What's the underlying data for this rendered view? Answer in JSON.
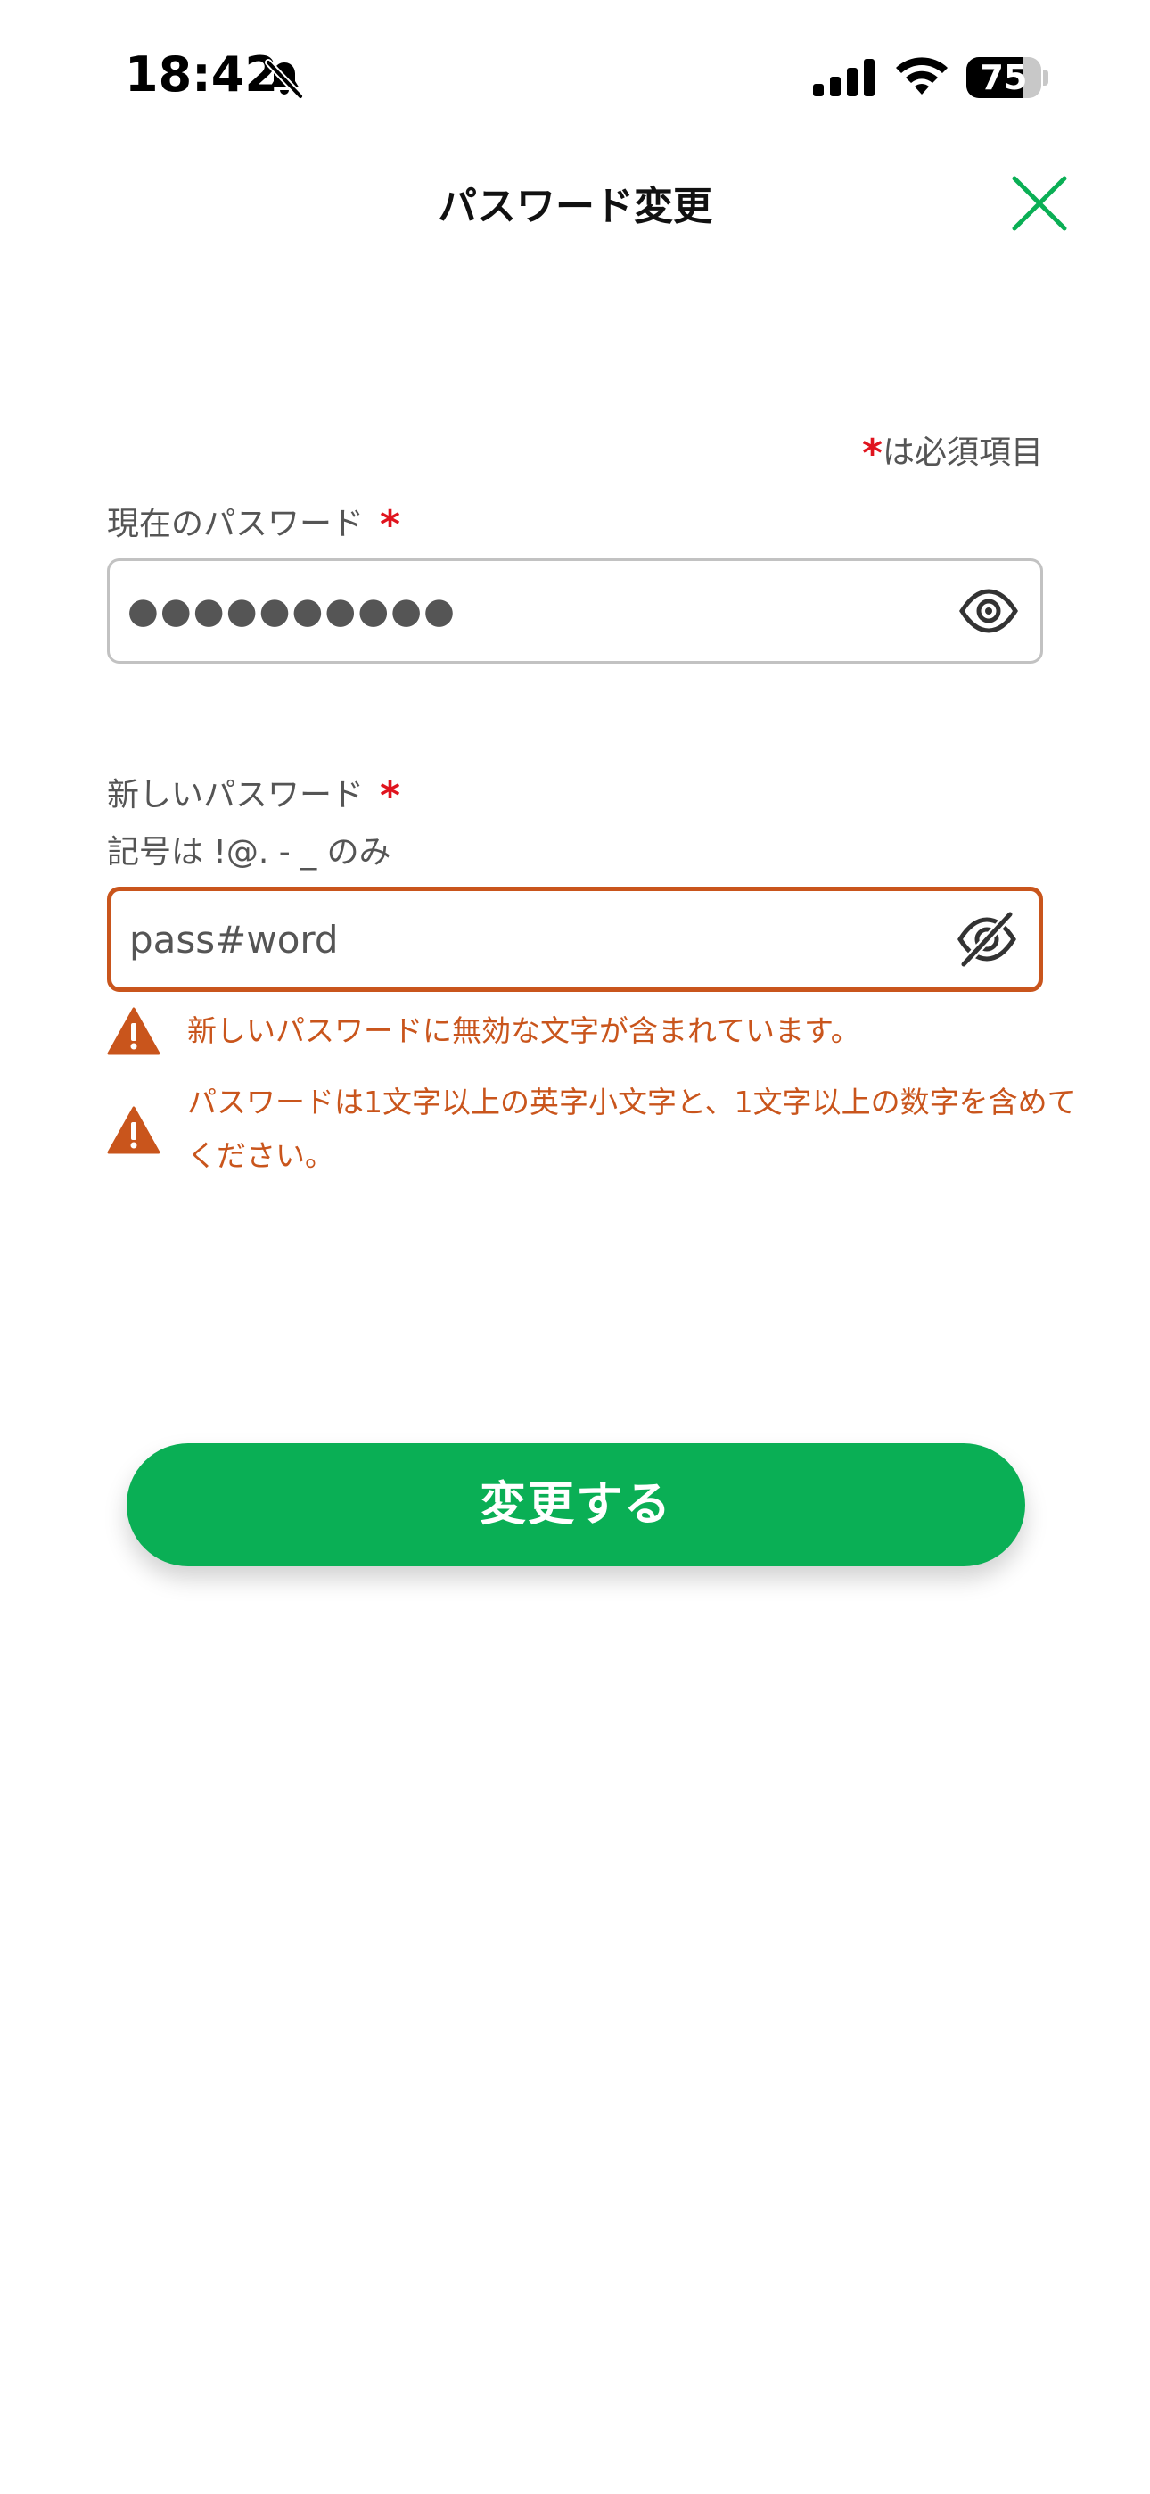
{
  "status_bar": {
    "time": "18:42",
    "battery_level": "75",
    "battery_fraction": 0.75
  },
  "header": {
    "title": "パスワード変更"
  },
  "form": {
    "required_note": "は必須項目",
    "required_mark": "*",
    "current_password": {
      "label": "現在のパスワード",
      "value": "●●●●●●●●●●"
    },
    "new_password": {
      "label": "新しいパスワード",
      "hint": "記号は !@. - _ のみ",
      "value": "pass#word",
      "errors": [
        "新しいパスワードに無効な文字が含まれています。",
        "パスワードは1文字以上の英字小文字と、1文字以上の数字を含めてください。"
      ]
    },
    "submit_label": "変更する"
  },
  "colors": {
    "accent": "#0aaf55",
    "error": "#c9551c",
    "required": "#e0141e"
  },
  "icons": {
    "mute": "bell-slash-icon",
    "signal": "cellular-signal-icon",
    "wifi": "wifi-icon",
    "close": "close-icon",
    "show": "eye-icon",
    "hide": "eye-slash-icon",
    "warning": "warning-icon"
  }
}
